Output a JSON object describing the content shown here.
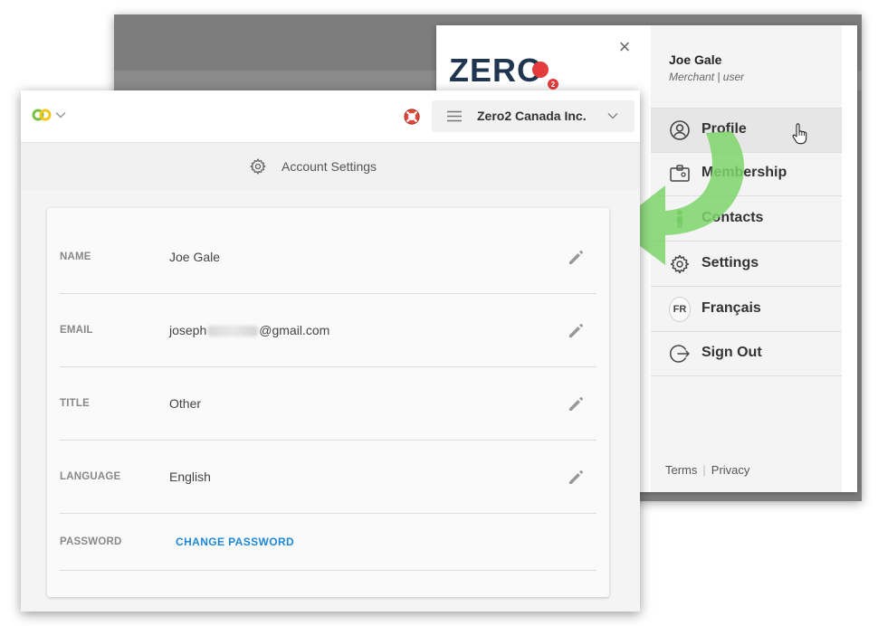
{
  "menu": {
    "close_icon": "×",
    "brand_name": "ZERO",
    "brand_badge": "2",
    "user": {
      "name": "Joe Gale",
      "role": "Merchant | user"
    },
    "items": [
      {
        "label": "Profile",
        "icon": "user-circle-icon",
        "active": true
      },
      {
        "label": "Membership",
        "icon": "id-card-icon"
      },
      {
        "label": "Contacts",
        "icon": "person-icon"
      },
      {
        "label": "Settings",
        "icon": "gear-icon"
      },
      {
        "label": "Français",
        "icon": "fr-badge",
        "badge": "FR"
      },
      {
        "label": "Sign Out",
        "icon": "sign-out-icon"
      }
    ],
    "footer": {
      "terms": "Terms",
      "separator": "|",
      "privacy": "Privacy"
    }
  },
  "app": {
    "org_name": "Zero2 Canada Inc.",
    "page_title": "Account Settings",
    "fields": [
      {
        "label": "NAME",
        "value": "Joe Gale"
      },
      {
        "label": "EMAIL",
        "value_prefix": "joseph",
        "value_suffix": "@gmail.com"
      },
      {
        "label": "TITLE",
        "value": "Other"
      },
      {
        "label": "LANGUAGE",
        "value": "English"
      },
      {
        "label": "PASSWORD",
        "action": "CHANGE PASSWORD"
      }
    ]
  },
  "colors": {
    "accent_blue": "#1e88d6",
    "brand_navy": "#1f3550",
    "brand_red": "#e43c3c",
    "logo_green": "#7ac143",
    "logo_yellow": "#f5c518",
    "arrow_green": "#7cd36a"
  }
}
